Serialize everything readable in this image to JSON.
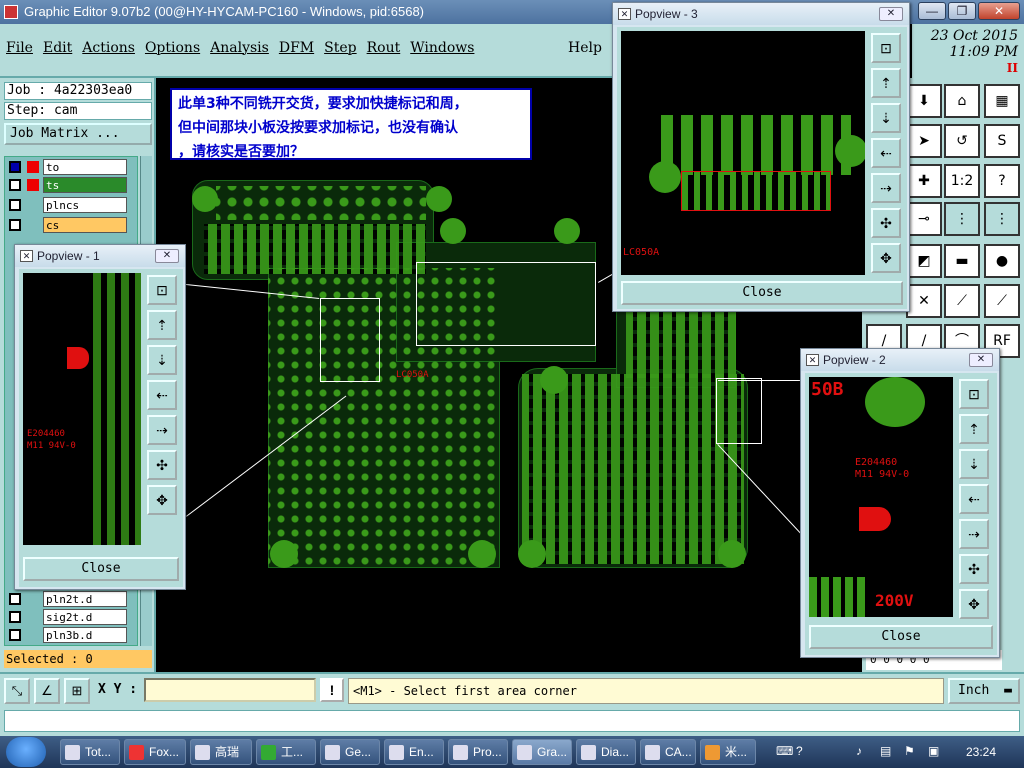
{
  "window": {
    "title": "Graphic Editor 9.07b2 (00@HY-HYCAM-PC160 - Windows, pid:6568)",
    "controls": [
      "—",
      "❐",
      "✕"
    ]
  },
  "menu": {
    "items": [
      "File",
      "Edit",
      "Actions",
      "Options",
      "Analysis",
      "DFM",
      "Step",
      "Rout",
      "Windows"
    ],
    "help": "Help"
  },
  "datetime": {
    "date": "23 Oct 2015",
    "time": "11:09 PM",
    "indicator": "II"
  },
  "left_panel": {
    "job": "Job : 4a22303ea0",
    "step": "Step: cam",
    "job_matrix": "Job Matrix ...",
    "layers": [
      "to",
      "ts",
      "plncs",
      "cs",
      "pln2t.d",
      "sig2t.d",
      "pln3b.d"
    ],
    "selected": "Selected : 0"
  },
  "note": {
    "line1": "此单3种不同铣开交货，要求加快捷标记和周，",
    "line2": "但中间那块小板没按要求加标记，也没有确认",
    "line3": "，请核实是否要加？"
  },
  "board_labels": {
    "lc050a": "LC050A",
    "fifty_b": "50B",
    "e204460": "E204460",
    "m11": "M11 94V-0",
    "v200": "200V"
  },
  "popviews": [
    {
      "title": "Popview - 1",
      "close": "Close"
    },
    {
      "title": "Popview - 2",
      "close": "Close"
    },
    {
      "title": "Popview - 3",
      "close": "Close"
    }
  ],
  "toolbox": {
    "scale_label": "1:2"
  },
  "bottom": {
    "xy_label": "X Y :",
    "xy_value": "",
    "bang": "!",
    "prompt": "<M1> - Select first area corner",
    "units": "Inch",
    "partial_readout": "0 0 0 0 0"
  },
  "taskbar": {
    "tasks": [
      "Tot...",
      "Fox...",
      "高瑞",
      "工...",
      "Ge...",
      "En...",
      "Pro...",
      "Gra...",
      "Dia...",
      "CA...",
      "米..."
    ],
    "clock": "23:24"
  },
  "colors": {
    "panel": "#b5dcda",
    "pad": "#3a9a1a",
    "silk": "#e01010",
    "note_text": "#0000cc"
  }
}
